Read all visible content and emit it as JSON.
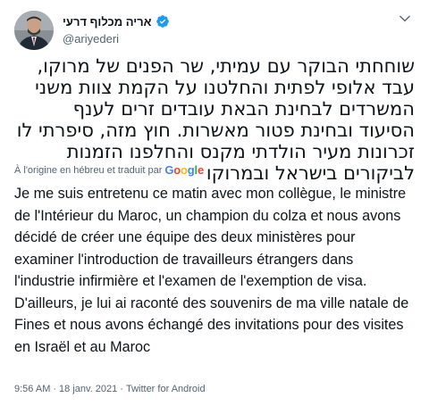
{
  "user": {
    "display_name": "אריה מכלוף דרעי",
    "handle": "@ariyederi",
    "verified": true,
    "avatar_icon": "avatar-photo",
    "more_icon": "chevron-down-icon"
  },
  "tweet": {
    "original_text": "שוחחתי הבוקר עם עמיתי, שר הפנים של מרוקו, עבד אלופי לפתית והחלטנו על הקמת צוות משני המשרדים לבחינת הבאת עובדים זרים לענף הסיעוד ובחינת פטור מאשרות. חוץ מזה, סיפרתי לו זכרונות מעיר הולדתי מקנס והחלפנו הזמנות לביקורים בישראל ובמרוקו",
    "translation_note": "À l'origine en hébreu et traduit par",
    "translation_provider": "Google",
    "translated_text": "Je me suis entretenu ce matin avec mon collègue, le ministre de l'Intérieur du Maroc, un champion du colza et nous avons décidé de créer une équipe des deux ministères pour examiner l'introduction de travailleurs étrangers dans l'industrie infirmière et l'examen de l'exemption de visa. D'ailleurs, je lui ai raconté des souvenirs de ma ville natale de Fines et nous avons échangé des invitations pour des visites en Israël et au Maroc"
  },
  "meta": {
    "time": "9:56 AM",
    "separator": "·",
    "date": "18 janv. 2021",
    "source": "Twitter for Android"
  },
  "colors": {
    "verified_blue": "#1d9bf0",
    "secondary_text": "#536471",
    "primary_text": "#0f1419"
  }
}
